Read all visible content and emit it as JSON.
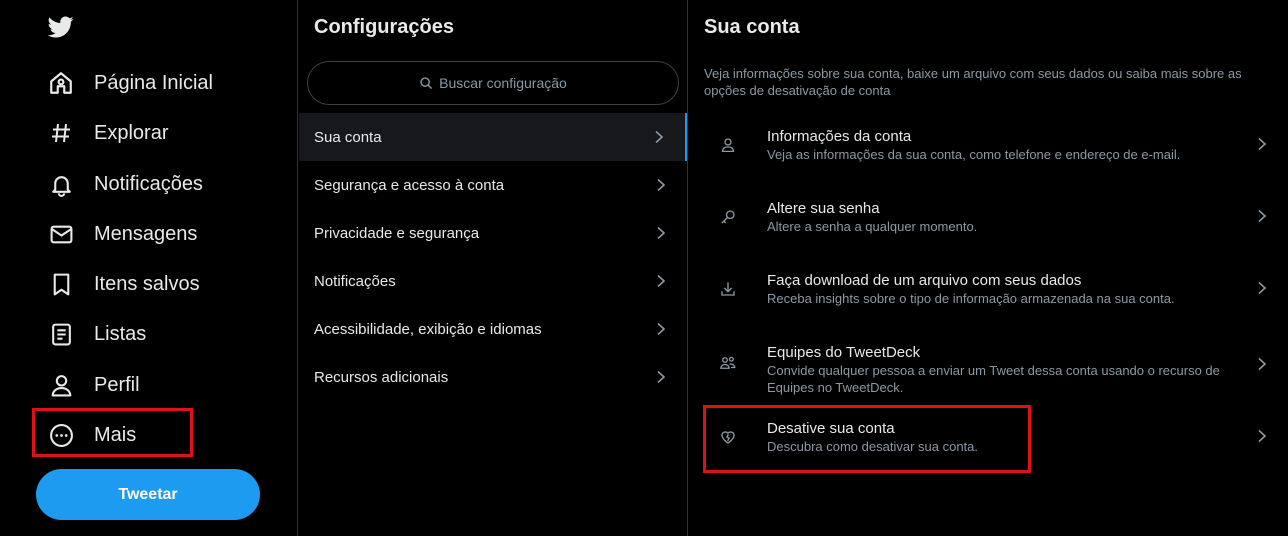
{
  "nav": {
    "items": [
      {
        "label": "Página Inicial",
        "icon": "home-icon"
      },
      {
        "label": "Explorar",
        "icon": "hashtag-icon"
      },
      {
        "label": "Notificações",
        "icon": "bell-icon"
      },
      {
        "label": "Mensagens",
        "icon": "envelope-icon"
      },
      {
        "label": "Itens salvos",
        "icon": "bookmark-icon"
      },
      {
        "label": "Listas",
        "icon": "list-icon"
      },
      {
        "label": "Perfil",
        "icon": "person-icon"
      },
      {
        "label": "Mais",
        "icon": "more-circle-icon"
      }
    ],
    "tweet_label": "Tweetar"
  },
  "settings": {
    "title": "Configurações",
    "search_placeholder": "Buscar configuração",
    "items": [
      {
        "label": "Sua conta"
      },
      {
        "label": "Segurança e acesso à conta"
      },
      {
        "label": "Privacidade e segurança"
      },
      {
        "label": "Notificações"
      },
      {
        "label": "Acessibilidade, exibição e idiomas"
      },
      {
        "label": "Recursos adicionais"
      }
    ]
  },
  "account": {
    "title": "Sua conta",
    "description": "Veja informações sobre sua conta, baixe um arquivo com seus dados ou saiba mais sobre as opções de desativação de conta",
    "rows": [
      {
        "title": "Informações da conta",
        "subtitle": "Veja as informações da sua conta, como telefone e endereço de e-mail.",
        "icon": "person-outline-icon"
      },
      {
        "title": "Altere sua senha",
        "subtitle": "Altere a senha a qualquer momento.",
        "icon": "key-icon"
      },
      {
        "title": "Faça download de um arquivo com seus dados",
        "subtitle": "Receba insights sobre o tipo de informação armazenada na sua conta.",
        "icon": "download-icon"
      },
      {
        "title": "Equipes do TweetDeck",
        "subtitle": "Convide qualquer pessoa a enviar um Tweet dessa conta usando o recurso de Equipes no TweetDeck.",
        "icon": "team-icon"
      },
      {
        "title": "Desative sua conta",
        "subtitle": "Descubra como desativar sua conta.",
        "icon": "broken-heart-icon"
      }
    ]
  },
  "colors": {
    "accent": "#1d9bf0",
    "highlight": "#e0101a",
    "background": "#000000",
    "secondary_text": "#8b98a5"
  }
}
